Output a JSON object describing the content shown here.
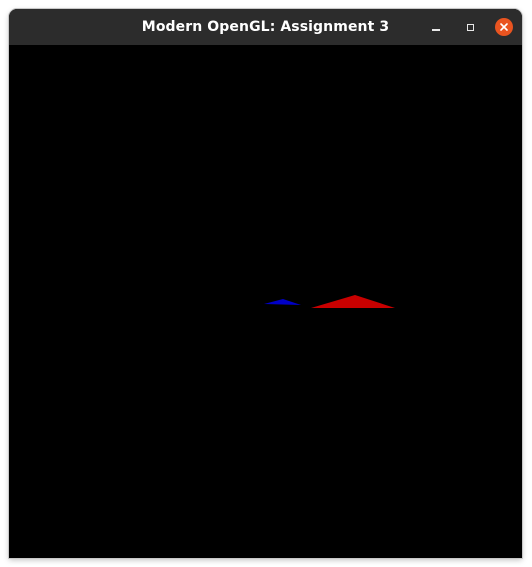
{
  "window": {
    "title": "Modern OpenGL: Assignment 3",
    "controls": [
      {
        "name": "minimize",
        "icon": "minimize-icon"
      },
      {
        "name": "maximize",
        "icon": "maximize-icon"
      },
      {
        "name": "close",
        "icon": "close-icon"
      }
    ],
    "close_color": "#e95420",
    "titlebar_color": "#2c2c2c"
  },
  "canvas": {
    "background": "#000000",
    "shapes": [
      {
        "name": "blue-triangle",
        "color": "#0000c8"
      },
      {
        "name": "red-triangle",
        "color": "#c80000"
      }
    ]
  }
}
